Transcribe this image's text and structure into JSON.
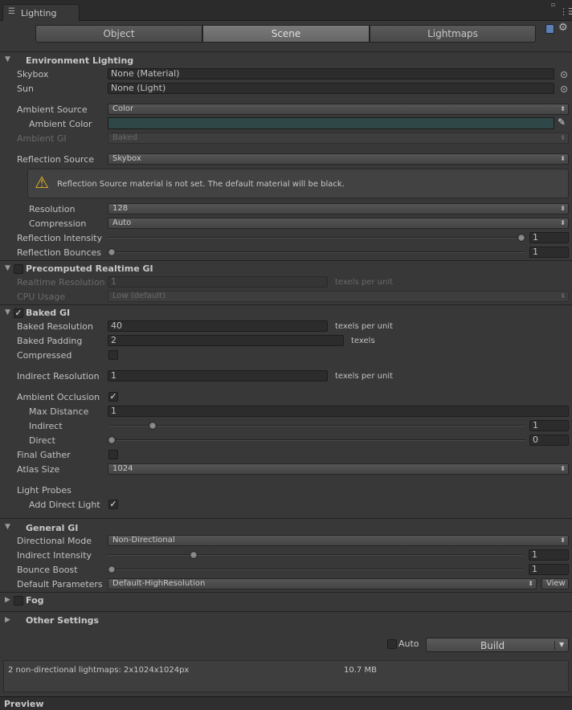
{
  "window": {
    "tab_title": "Lighting"
  },
  "tabs": [
    "Object",
    "Scene",
    "Lightmaps"
  ],
  "environment": {
    "title": "Environment Lighting",
    "skybox_label": "Skybox",
    "skybox_value": "None (Material)",
    "sun_label": "Sun",
    "sun_value": "None (Light)",
    "ambient_source_label": "Ambient Source",
    "ambient_source_value": "Color",
    "ambient_color_label": "Ambient Color",
    "ambient_color_value": "#304748",
    "ambient_gi_label": "Ambient GI",
    "ambient_gi_value": "Baked",
    "reflection_source_label": "Reflection Source",
    "reflection_source_value": "Skybox",
    "warning_text": "Reflection Source material is not set. The default material will be black.",
    "resolution_label": "Resolution",
    "resolution_value": "128",
    "compression_label": "Compression",
    "compression_value": "Auto",
    "reflection_intensity_label": "Reflection Intensity",
    "reflection_intensity_value": "1",
    "reflection_intensity_fraction": 1.0,
    "reflection_bounces_label": "Reflection Bounces",
    "reflection_bounces_value": "1",
    "reflection_bounces_fraction": 0.0
  },
  "realtime_gi": {
    "title": "Precomputed Realtime GI",
    "resolution_label": "Realtime Resolution",
    "resolution_value": "1",
    "resolution_unit": "texels per unit",
    "cpu_usage_label": "CPU Usage",
    "cpu_usage_value": "Low (default)"
  },
  "baked_gi": {
    "title": "Baked GI",
    "resolution_label": "Baked Resolution",
    "resolution_value": "40",
    "resolution_unit": "texels per unit",
    "padding_label": "Baked Padding",
    "padding_value": "2",
    "padding_unit": "texels",
    "compressed_label": "Compressed",
    "indirect_resolution_label": "Indirect Resolution",
    "indirect_resolution_value": "1",
    "indirect_resolution_unit": "texels per unit",
    "ambient_occlusion_label": "Ambient Occlusion",
    "max_distance_label": "Max Distance",
    "max_distance_value": "1",
    "indirect_label": "Indirect",
    "indirect_value": "1",
    "indirect_fraction": 0.1,
    "direct_label": "Direct",
    "direct_value": "0",
    "direct_fraction": 0.0,
    "final_gather_label": "Final Gather",
    "atlas_size_label": "Atlas Size",
    "atlas_size_value": "1024",
    "light_probes_label": "Light Probes",
    "add_direct_light_label": "Add Direct Light"
  },
  "general_gi": {
    "title": "General GI",
    "directional_mode_label": "Directional Mode",
    "directional_mode_value": "Non-Directional",
    "indirect_intensity_label": "Indirect Intensity",
    "indirect_intensity_value": "1",
    "indirect_intensity_fraction": 0.2,
    "bounce_boost_label": "Bounce Boost",
    "bounce_boost_value": "1",
    "bounce_boost_fraction": 0.0,
    "default_parameters_label": "Default Parameters",
    "default_parameters_value": "Default-HighResolution",
    "view_label": "View"
  },
  "fog": {
    "title": "Fog"
  },
  "other_settings": {
    "title": "Other Settings"
  },
  "build": {
    "auto_label": "Auto",
    "build_label": "Build"
  },
  "stats": {
    "lightmaps_text": "2 non-directional lightmaps: 2x1024x1024px",
    "size_text": "10.7 MB"
  },
  "preview": {
    "label": "Preview"
  }
}
